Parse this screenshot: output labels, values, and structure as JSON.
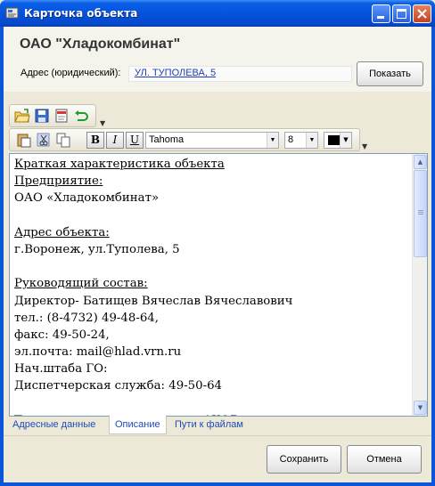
{
  "window": {
    "title": "Карточка объекта",
    "controls": {
      "minimize": "minimize-icon",
      "maximize": "maximize-icon",
      "close": "close-icon"
    }
  },
  "header": {
    "org_name": "ОАО \"Хладокомбинат\"",
    "address_label": "Адрес (юридический):",
    "address_value": "УЛ. ТУПОЛЕВА, 5",
    "show_button": "Показать"
  },
  "toolbar": {
    "icons": [
      "open-folder-icon",
      "save-icon",
      "new-document-icon",
      "undo-icon"
    ],
    "edit_icons": [
      "paste-icon",
      "cut-icon",
      "copy-icon"
    ],
    "bold": "B",
    "italic": "I",
    "underline": "U",
    "font_name": "Tahoma",
    "font_size": "8",
    "text_color": "#000000"
  },
  "document": {
    "lines": [
      {
        "text": "Краткая характеристика объекта",
        "underline": true
      },
      {
        "text": "Предприятие:",
        "underline": true
      },
      {
        "text": "ОАО «Хладокомбинат»",
        "underline": false
      },
      {
        "text": "",
        "underline": false
      },
      {
        "text": "Адрес объекта:",
        "underline": true
      },
      {
        "text": "г.Воронеж, ул.Туполева, 5",
        "underline": false
      },
      {
        "text": "",
        "underline": false
      },
      {
        "text": "Руководящий состав:",
        "underline": true
      },
      {
        "text": "Директор- Батищев Вячеслав Вячеславович",
        "underline": false
      },
      {
        "text": "тел.: (8-4732) 49-48-64,",
        "underline": false
      },
      {
        "text": "факс: 49-50-24,",
        "underline": false
      },
      {
        "text": "эл.почта: mail@hlad.vrn.ru",
        "underline": false
      },
      {
        "text": "Нач.штаба ГО:",
        "underline": false
      },
      {
        "text": "Диспетчерская служба: 49-50-64",
        "underline": false
      },
      {
        "text": "",
        "underline": false
      },
      {
        "text": "Техническая характеристика АХОВ:",
        "underline": true
      }
    ]
  },
  "tabs": [
    {
      "label": "Адресные данные",
      "active": false
    },
    {
      "label": "Описание",
      "active": true
    },
    {
      "label": "Пути к файлам",
      "active": false
    }
  ],
  "buttons": {
    "save": "Сохранить",
    "cancel": "Отмена"
  }
}
